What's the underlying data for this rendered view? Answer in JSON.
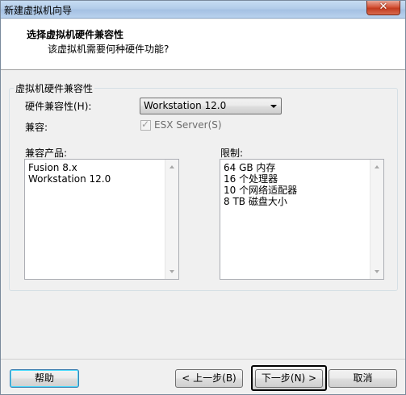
{
  "window": {
    "title": "新建虚拟机向导",
    "close_label": "✕"
  },
  "header": {
    "title": "选择虚拟机硬件兼容性",
    "subtitle": "该虚拟机需要何种硬件功能?"
  },
  "group": {
    "label": "虚拟机硬件兼容性",
    "hw_compat_label": "硬件兼容性(H):",
    "hw_compat_value": "Workstation 12.0",
    "compat_label": "兼容:",
    "esx_label": "ESX Server(S)",
    "esx_checked": true,
    "esx_enabled": false
  },
  "products": {
    "label": "兼容产品:",
    "items": [
      "Fusion 8.x",
      "Workstation 12.0"
    ]
  },
  "limits": {
    "label": "限制:",
    "items": [
      "64 GB 内存",
      "16 个处理器",
      "10 个网络适配器",
      "8 TB 磁盘大小"
    ]
  },
  "buttons": {
    "help": "帮助",
    "back": "< 上一步(B)",
    "next": "下一步(N) >",
    "cancel": "取消"
  }
}
